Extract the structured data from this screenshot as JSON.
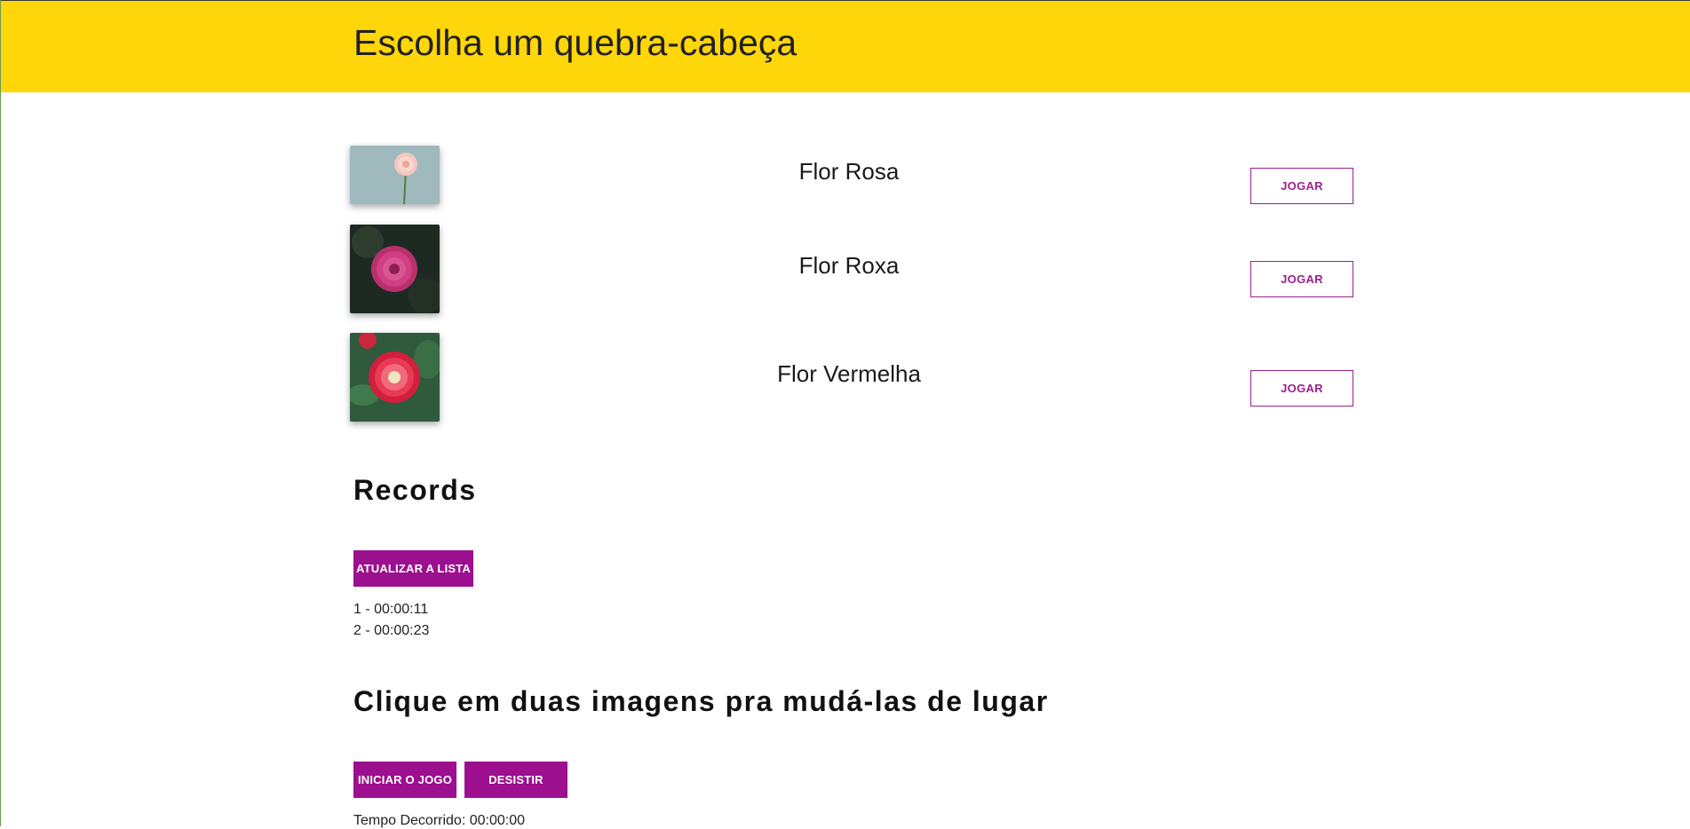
{
  "header": {
    "title": "Escolha um quebra-cabeça"
  },
  "puzzles": [
    {
      "name": "Flor Rosa",
      "button_label": "JOGAR",
      "image_icon": "pink-flower-photo"
    },
    {
      "name": "Flor Roxa",
      "button_label": "JOGAR",
      "image_icon": "purple-flower-photo"
    },
    {
      "name": "Flor Vermelha",
      "button_label": "JOGAR",
      "image_icon": "red-flower-photo"
    }
  ],
  "records": {
    "title": "Records",
    "refresh_label": "ATUALIZAR A LISTA",
    "items": [
      "1 - 00:00:11",
      "2 - 00:00:23"
    ]
  },
  "game": {
    "title": "Clique em duas imagens pra mudá-las de lugar",
    "start_label": "INICIAR O JOGO",
    "quit_label": "DESISTIR",
    "elapsed_text": "Tempo Decorrido: 00:00:00"
  },
  "colors": {
    "header_bg": "#ffd60a",
    "accent": "#9c0f8e"
  }
}
